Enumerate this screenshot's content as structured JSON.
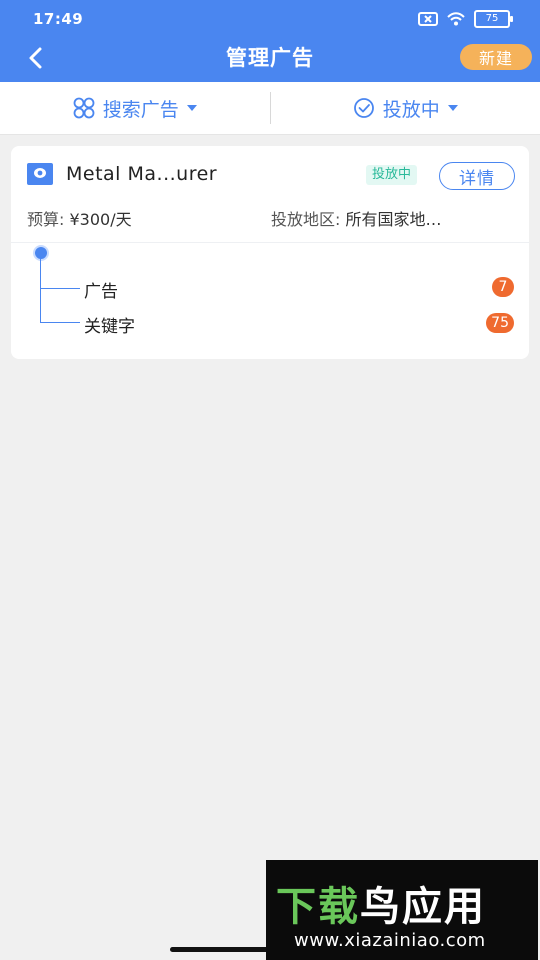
{
  "status_bar": {
    "time": "17:49",
    "battery": "75",
    "icons": [
      "sim-x-icon",
      "wifi-icon",
      "battery-icon"
    ]
  },
  "header": {
    "title": "管理广告",
    "new_label": "新建",
    "back_icon": "chevron-left-icon"
  },
  "filters": {
    "search_label": "搜索广告",
    "status_label": "投放中"
  },
  "campaign": {
    "name": "Metal Ma...urer",
    "status": "投放中",
    "details_label": "详情",
    "budget_label": "预算:",
    "budget_value": "¥300/天",
    "region_label": "投放地区:",
    "region_value": "所有国家地…",
    "tree": [
      {
        "label": "广告",
        "count": "7"
      },
      {
        "label": "关键字",
        "count": "75"
      }
    ]
  },
  "watermark": {
    "big_text_accent": "下载",
    "big_text_rest": "鸟应用",
    "url": "www.xiazainiao.com"
  },
  "colors": {
    "primary": "#4a86f0",
    "new_button": "#f5b25a",
    "count_badge": "#ef6a2f",
    "status_badge_text": "#2ab99a"
  }
}
